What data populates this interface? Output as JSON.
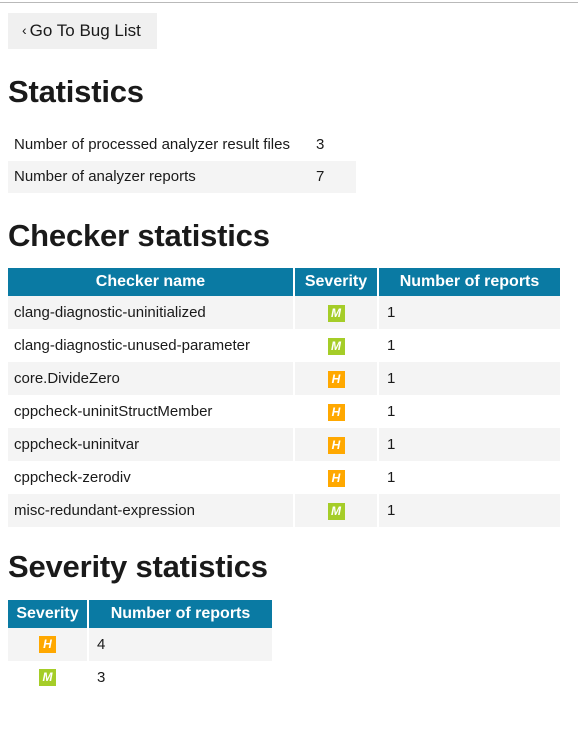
{
  "colors": {
    "table_header_bg": "#0a7aa3",
    "row_alt_bg": "#f4f4f4",
    "button_bg": "#f0f0f0",
    "severity_high": "#ffa800",
    "severity_medium": "#a5cd28"
  },
  "nav": {
    "back_chevron": "‹",
    "back_label": "Go To Bug List"
  },
  "statistics": {
    "title": "Statistics",
    "rows": [
      {
        "label": "Number of processed analyzer result files",
        "value": "3"
      },
      {
        "label": "Number of analyzer reports",
        "value": "7"
      }
    ]
  },
  "checker_statistics": {
    "title": "Checker statistics",
    "columns": [
      "Checker name",
      "Severity",
      "Number of reports"
    ],
    "rows": [
      {
        "name": "clang-diagnostic-uninitialized",
        "severity": "M",
        "severity_name": "medium",
        "count": "1"
      },
      {
        "name": "clang-diagnostic-unused-parameter",
        "severity": "M",
        "severity_name": "medium",
        "count": "1"
      },
      {
        "name": "core.DivideZero",
        "severity": "H",
        "severity_name": "high",
        "count": "1"
      },
      {
        "name": "cppcheck-uninitStructMember",
        "severity": "H",
        "severity_name": "high",
        "count": "1"
      },
      {
        "name": "cppcheck-uninitvar",
        "severity": "H",
        "severity_name": "high",
        "count": "1"
      },
      {
        "name": "cppcheck-zerodiv",
        "severity": "H",
        "severity_name": "high",
        "count": "1"
      },
      {
        "name": "misc-redundant-expression",
        "severity": "M",
        "severity_name": "medium",
        "count": "1"
      }
    ]
  },
  "severity_statistics": {
    "title": "Severity statistics",
    "columns": [
      "Severity",
      "Number of reports"
    ],
    "rows": [
      {
        "severity": "H",
        "severity_name": "high",
        "count": "4"
      },
      {
        "severity": "M",
        "severity_name": "medium",
        "count": "3"
      }
    ]
  }
}
